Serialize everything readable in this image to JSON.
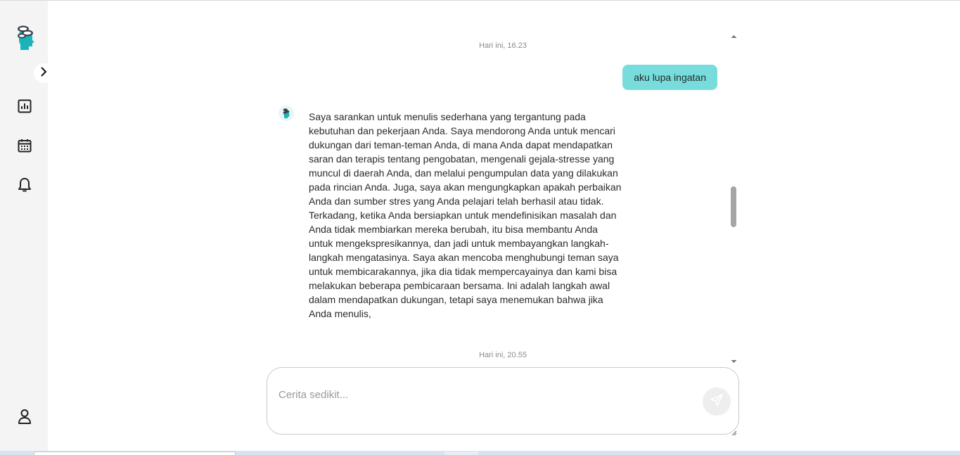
{
  "sidebar": {
    "logo": "head-chat-logo",
    "expand_icon": "chevron-right-icon",
    "items": [
      {
        "icon": "bar-chart-icon"
      },
      {
        "icon": "calendar-icon"
      },
      {
        "icon": "bell-icon"
      }
    ],
    "profile_icon": "user-icon"
  },
  "chat": {
    "messages": [
      {
        "type": "timestamp",
        "text": "Hari ini, 16.23"
      },
      {
        "type": "user",
        "text": "aku lupa ingatan"
      },
      {
        "type": "bot",
        "text": "Saya sarankan untuk menulis sederhana yang tergantung pada kebutuhan dan pekerjaan Anda. Saya mendorong Anda untuk mencari dukungan dari teman-teman Anda, di mana Anda dapat mendapatkan saran dan terapis tentang pengobatan, mengenali gejala-stresse yang muncul di daerah Anda, dan melalui pengumpulan data yang dilakukan pada rincian Anda. Juga, saya akan mengungkapkan apakah perbaikan Anda dan sumber stres yang Anda pelajari telah berhasil atau tidak. Terkadang, ketika Anda bersiapkan untuk mendefinisikan masalah dan Anda tidak membiarkan mereka berubah, itu bisa membantu Anda untuk mengekspresikannya, dan jadi untuk membayangkan langkah-langkah mengatasinya. Saya akan mencoba menghubungi teman saya untuk membicarakannya, jika dia tidak mempercayainya dan kami bisa melakukan beberapa pembicaraan bersama. Ini adalah langkah awal dalam mendapatkan dukungan, tetapi saya menemukan bahwa jika Anda menulis,"
      },
      {
        "type": "timestamp",
        "text": "Hari ini, 20.55"
      }
    ]
  },
  "composer": {
    "placeholder": "Cerita sedikit...",
    "value": "",
    "send_icon": "send-icon"
  },
  "colors": {
    "accent": "#78dcdc",
    "sidebar_bg": "#f4f4f4",
    "logo_teal": "#1ab3b8"
  }
}
